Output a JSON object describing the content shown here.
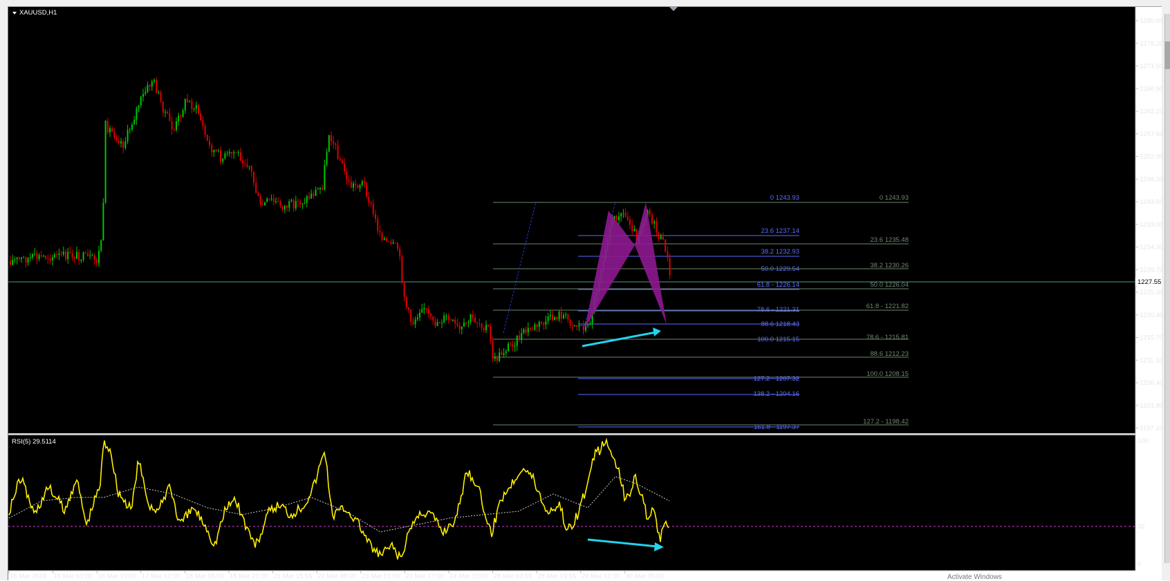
{
  "window": {
    "title": "XAUUSD,H1",
    "bottom_caption": "Activate Windows"
  },
  "colors": {
    "background": "#000000",
    "bull_candle": "#00c800",
    "bear_candle": "#e00000",
    "fib_left": "#5b6dff",
    "fib_right": "#6f8a6f",
    "pattern_fill": "#8e1890",
    "divergence_arrow": "#22d3ee",
    "rsi_line": "#ffee00",
    "rsi_signal": "#d0d0d0",
    "rsi_level": "#d040d0",
    "current_price_line": "#5fa8a0"
  },
  "price_axis": {
    "ticks": [
      "1280.80",
      "1276.20",
      "1271.50",
      "1266.90",
      "1262.20",
      "1257.60",
      "1252.90",
      "1248.30",
      "1243.60",
      "1239.00",
      "1234.30",
      "1229.70",
      "1225.00",
      "1220.40",
      "1215.70",
      "1211.10",
      "1206.40",
      "1201.80",
      "1197.10"
    ],
    "current_price": "1227.55"
  },
  "time_axis": {
    "labels": [
      "15 Mar 2016",
      "16 Mar 03:00",
      "16 Mar 19:00",
      "17 Mar 12:00",
      "18 Mar 05:00",
      "18 Mar 21:00",
      "21 Mar 15:55",
      "22 Mar 08:00",
      "23 Mar 01:00",
      "23 Mar 17:00",
      "24 Mar 10:00",
      "28 Mar 03:55",
      "28 Mar 19:55",
      "29 Mar 12:00",
      "30 Mar 05:00"
    ]
  },
  "fibonacci": {
    "left_set": [
      {
        "label": "0 1243.93"
      },
      {
        "label": "23.6 1237.14"
      },
      {
        "label": "38.2 1232.93"
      },
      {
        "label": "50.0 1229.54"
      },
      {
        "label": "61.8 - 1226.14"
      },
      {
        "label": "78.6 - 1221.31"
      },
      {
        "label": "88.6 1218.43"
      },
      {
        "label": "100.0 1215.15"
      },
      {
        "label": "127.2 - 1207.32"
      },
      {
        "label": "138.2 - 1204.16"
      },
      {
        "label": "161.8 - 1197.37"
      }
    ],
    "right_set": [
      {
        "label": "0 1243.93"
      },
      {
        "label": "23.6 1235.48"
      },
      {
        "label": "38.2 1230.26"
      },
      {
        "label": "50.0 1226.04"
      },
      {
        "label": "61.8 - 1221.82"
      },
      {
        "label": "78.6 - 1215.81"
      },
      {
        "label": "88.6 1212.23"
      },
      {
        "label": "100.0 1208.15"
      },
      {
        "label": "127.2 - 1198.42"
      }
    ]
  },
  "rsi": {
    "label": "RSI(5) 29.5114",
    "level_ticks": [
      "100",
      "32",
      "0"
    ]
  },
  "chart_data": {
    "type": "line",
    "title": "XAUUSD,H1",
    "series": [
      {
        "name": "XAUUSD",
        "x": [
          "15 Mar 2016",
          "16 Mar 03:00",
          "16 Mar 19:00",
          "17 Mar 12:00",
          "18 Mar 05:00",
          "18 Mar 21:00",
          "21 Mar 15:55",
          "22 Mar 08:00",
          "23 Mar 01:00",
          "23 Mar 17:00",
          "24 Mar 10:00",
          "28 Mar 03:55",
          "28 Mar 19:55",
          "29 Mar 12:00",
          "30 Mar 05:00"
        ],
        "values": [
          1231.5,
          1230.0,
          1262.0,
          1268.0,
          1262.0,
          1250.0,
          1243.0,
          1257.0,
          1232.0,
          1220.0,
          1221.0,
          1215.0,
          1221.0,
          1241.0,
          1226.0
        ]
      },
      {
        "name": "RSI(5)",
        "x": [
          "15 Mar 2016",
          "16 Mar 03:00",
          "16 Mar 19:00",
          "17 Mar 12:00",
          "18 Mar 05:00",
          "18 Mar 21:00",
          "21 Mar 15:55",
          "22 Mar 08:00",
          "23 Mar 01:00",
          "23 Mar 17:00",
          "24 Mar 10:00",
          "28 Mar 03:55",
          "28 Mar 19:55",
          "29 Mar 12:00",
          "30 Mar 05:00"
        ],
        "values": [
          55,
          60,
          95,
          80,
          40,
          60,
          55,
          90,
          10,
          40,
          65,
          45,
          75,
          96,
          30
        ]
      }
    ],
    "ylim": [
      1197.1,
      1280.8
    ],
    "rsi_ylim": [
      0,
      100
    ],
    "rsi_level": 32,
    "grid": false,
    "legend": "top-left"
  }
}
